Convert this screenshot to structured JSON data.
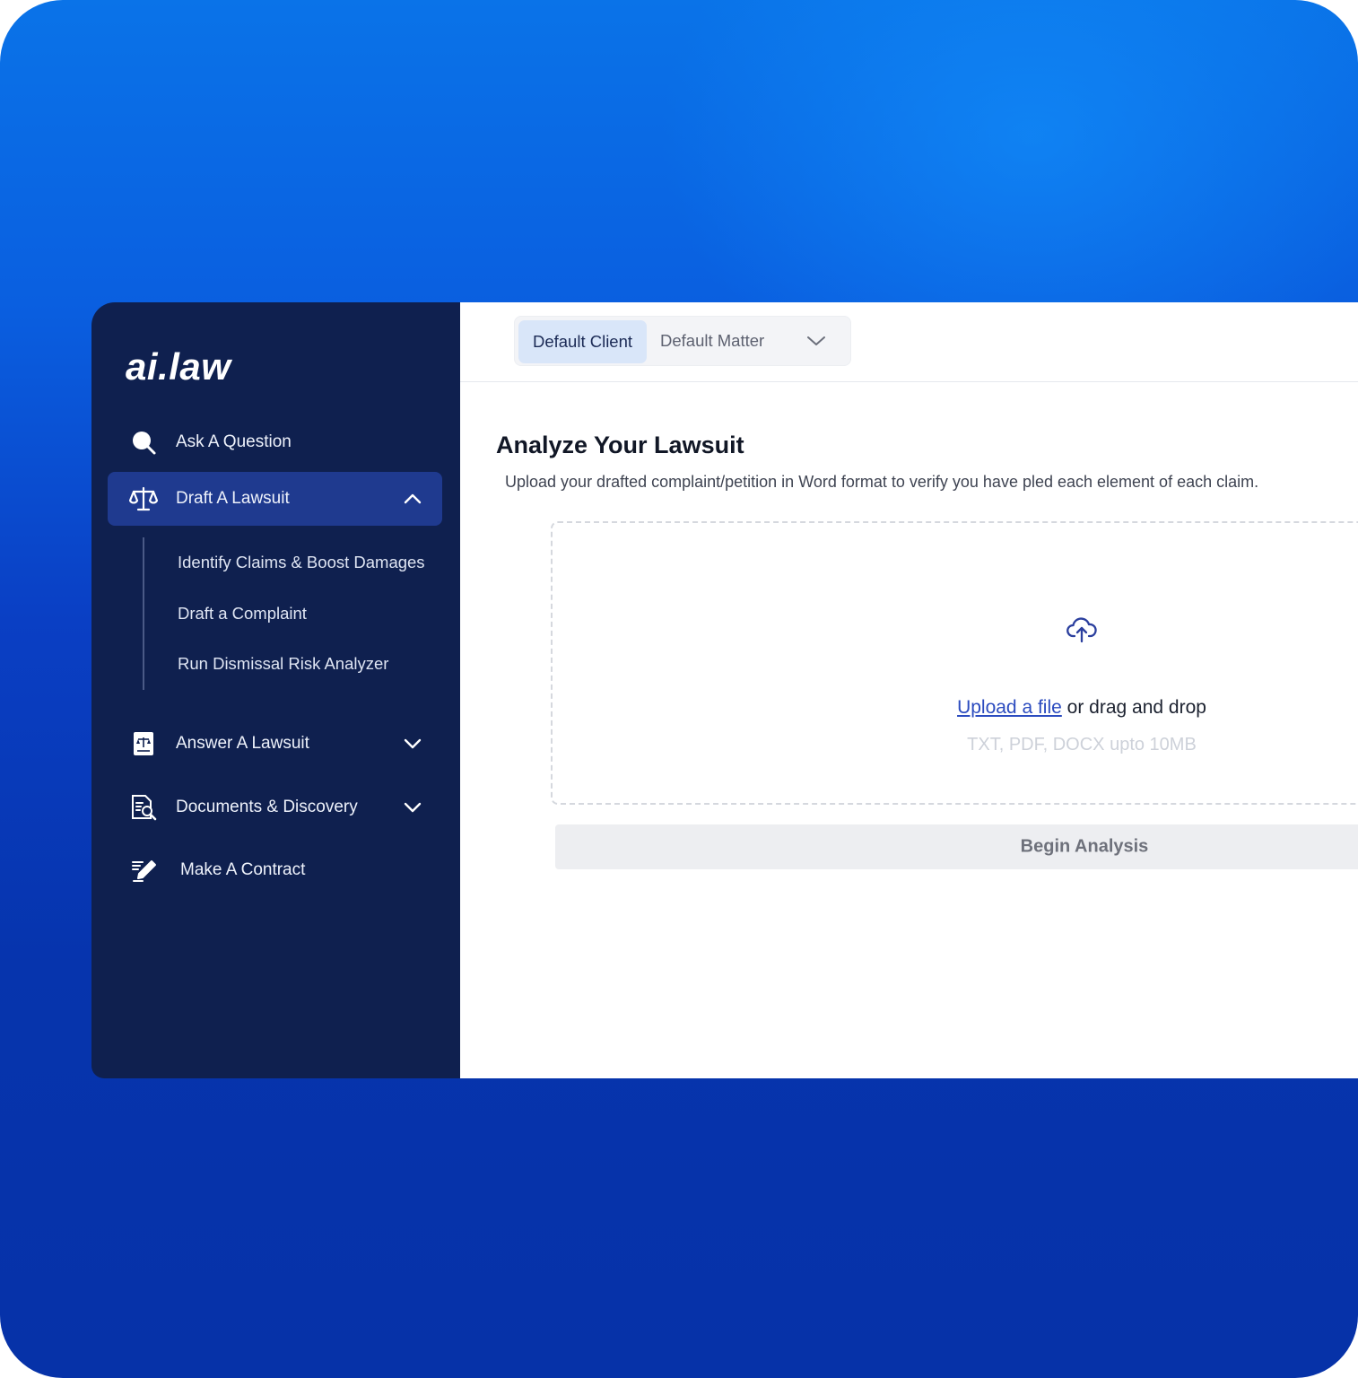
{
  "brand": {
    "logo_text": "ai.law"
  },
  "sidebar": {
    "items": [
      {
        "label": "Ask A Question",
        "icon": "search-icon"
      },
      {
        "label": "Draft A Lawsuit",
        "icon": "scale-icon",
        "expanded": true,
        "children": [
          "Identify Claims & Boost Damages",
          "Draft a Complaint",
          "Run Dismissal Risk Analyzer"
        ]
      },
      {
        "label": "Answer A Lawsuit",
        "icon": "legal-document-icon",
        "expanded": false
      },
      {
        "label": "Documents & Discovery",
        "icon": "document-search-icon",
        "expanded": false
      },
      {
        "label": "Make A Contract",
        "icon": "contract-pen-icon"
      }
    ]
  },
  "topbar": {
    "client_label": "Default Client",
    "matter_label": "Default Matter"
  },
  "main": {
    "title": "Analyze Your Lawsuit",
    "subtitle": "Upload your drafted complaint/petition in Word format to verify you have pled each element of each claim.",
    "upload": {
      "link_text": "Upload a file",
      "rest_text": " or drag and drop",
      "hint": "TXT, PDF, DOCX upto 10MB"
    },
    "begin_button": "Begin Analysis"
  },
  "colors": {
    "sidebar_bg": "#0f204f",
    "active_item_bg": "#1f3a8f",
    "accent_link": "#2b4bbf",
    "client_pill_bg": "#d9e6f9"
  }
}
